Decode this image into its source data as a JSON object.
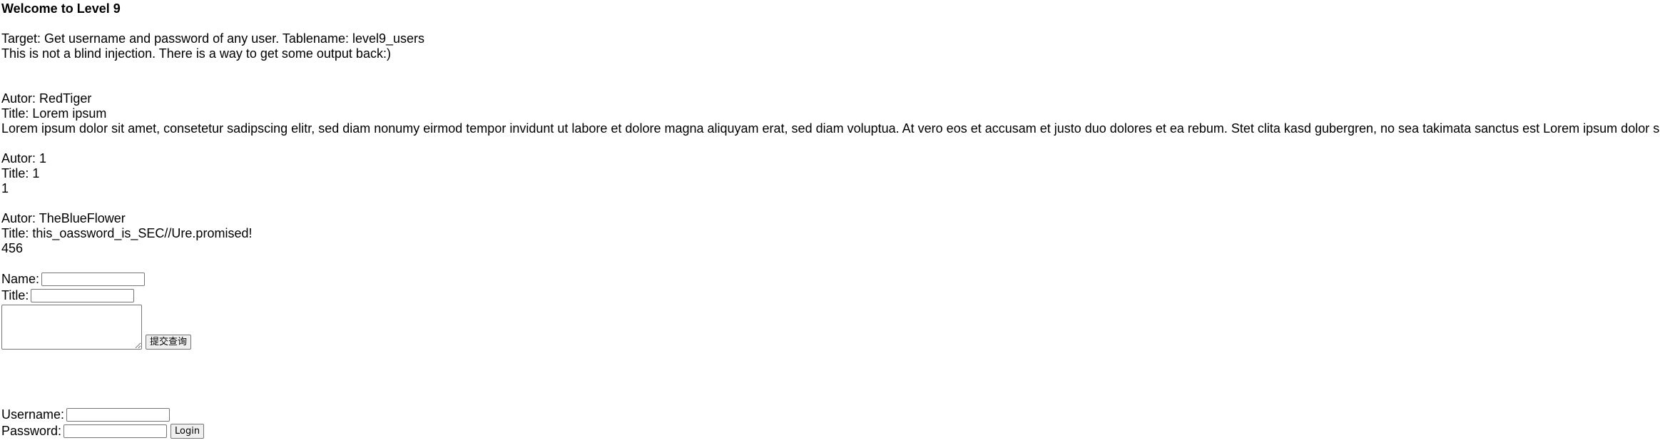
{
  "heading": "Welcome to Level 9",
  "intro": {
    "target": "Target: Get username and password of any user. Tablename: level9_users",
    "hint": "This is not a blind injection. There is a way to get some output back:)"
  },
  "entries": [
    {
      "author": "Autor: RedTiger",
      "title": "Title: Lorem ipsum",
      "body": "Lorem ipsum dolor sit amet, consetetur sadipscing elitr, sed diam nonumy eirmod tempor invidunt ut labore et dolore magna aliquyam erat, sed diam voluptua. At vero eos et accusam et justo duo dolores et ea rebum. Stet clita kasd gubergren, no sea takimata sanctus est Lorem ipsum dolor sit amet."
    },
    {
      "author": "Autor: 1",
      "title": "Title: 1",
      "body": "1"
    },
    {
      "author": "Autor: TheBlueFlower",
      "title": "Title: this_oassword_is_SEC//Ure.promised!",
      "body": "456"
    }
  ],
  "post_form": {
    "name_label": "Name:",
    "name_value": "",
    "title_label": "Title:",
    "title_value": "",
    "text_value": "",
    "submit_label": "提交查询"
  },
  "login_form": {
    "username_label": "Username:",
    "username_value": "",
    "password_label": "Password:",
    "password_value": "",
    "login_label": "Login"
  }
}
